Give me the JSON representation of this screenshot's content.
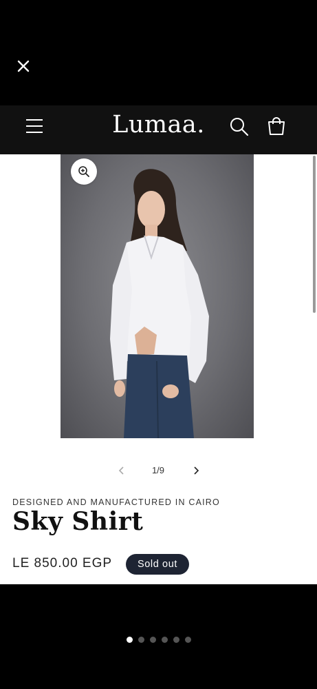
{
  "modal": {
    "close_icon": "close-icon"
  },
  "header": {
    "logo": "Lumaa.",
    "menu_icon": "hamburger-menu-icon",
    "search_icon": "search-icon",
    "cart_icon": "shopping-bag-icon"
  },
  "gallery": {
    "counter": "1/9",
    "zoom_icon": "zoom-in-icon",
    "image_alt": "Model wearing white shirt and blue jeans",
    "current_index": 1,
    "total": 9
  },
  "product": {
    "vendor": "DESIGNED AND MANUFACTURED IN CAIRO",
    "title": "Sky Shirt",
    "price": "LE 850.00 EGP",
    "badge": "Sold out"
  },
  "pagination": {
    "count": 6,
    "active": 0
  },
  "colors": {
    "badge_bg": "#1e2433",
    "header_bg": "#111111"
  }
}
